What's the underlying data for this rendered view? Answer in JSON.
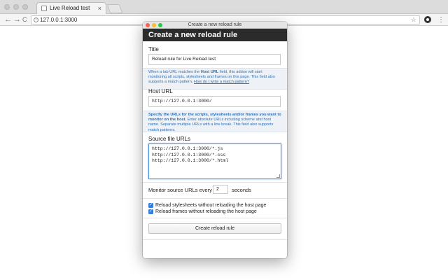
{
  "browser": {
    "tab_title": "Live Reload test",
    "tab_close": "×",
    "url": "127.0.0.1:3000",
    "icons": [
      "back-icon",
      "forward-icon",
      "reload-icon",
      "info-icon",
      "star-icon",
      "extension-icon",
      "menu-icon"
    ],
    "nav_back": "←",
    "nav_forward": "→",
    "nav_reload": "C",
    "info": "i",
    "star": "☆",
    "menu": "⋮"
  },
  "popup": {
    "window_title": "Create a new reload rule",
    "header": "Create a new reload rule",
    "title_label": "Title",
    "title_value": "Reload rule for Live Reload test",
    "host_hint_1": "When a tab URL matches the ",
    "host_hint_bold": "Host URL",
    "host_hint_2": " field, this addon will start monitoring all scripts, stylesheets and frames on this page. This field also supports a match pattern. ",
    "host_hint_link": "How do I write a match pattern?",
    "host_label": "Host URL",
    "host_value": "http://127.0.0.1:3000/",
    "source_hint_bold": "Specify the URLs for the scripts, stylesheets and/or frames you want to monitor on the host.",
    "source_hint_rest": " Enter absolute URLs including scheme and host name. Separate multiple URLs with a line break. This field also supports match patterns.",
    "source_label": "Source file URLs",
    "source_lines": [
      "http://127.0.0.1:3000/*.js",
      "http://127.0.0.1:3000/*.css",
      "http://127.0.0.1:3000/*.html"
    ],
    "monitor_label": "Monitor source URLs every",
    "monitor_value": "2",
    "monitor_unit": "seconds",
    "check_stylesheets": "Reload stylesheets without reloading the host page",
    "check_frames": "Reload frames without reloading the host page",
    "check_mark": "✓",
    "create_button": "Create reload rule"
  },
  "colors": {
    "header_bg": "#2b2b2b",
    "hint_text": "#2c6fb7",
    "focus_border": "#4a90d9",
    "checkbox": "#2f7ee6",
    "close_light": "#fc5f57",
    "min_light": "#fdbc2e",
    "max_light": "#28c840"
  }
}
